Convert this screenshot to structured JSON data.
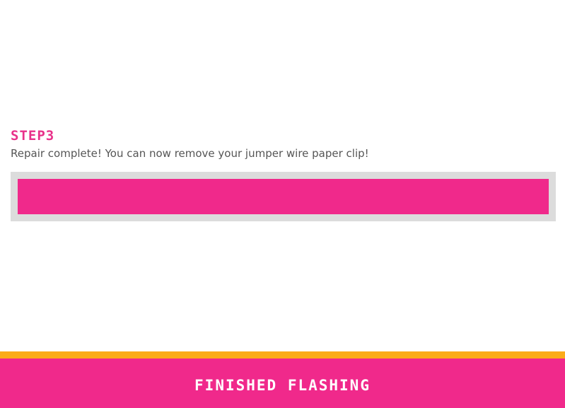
{
  "step": {
    "title": "STEP3",
    "description": "Repair complete! You can now remove your jumper wire paper clip!"
  },
  "progress": {
    "percent": 100
  },
  "footer": {
    "button_label": "FINISHED FLASHING"
  },
  "colors": {
    "accent_pink": "#f0298b",
    "title_pink": "#e8318a",
    "accent_orange": "#fbab19",
    "track_gray": "#dcdcdc",
    "text_gray": "#555555"
  }
}
